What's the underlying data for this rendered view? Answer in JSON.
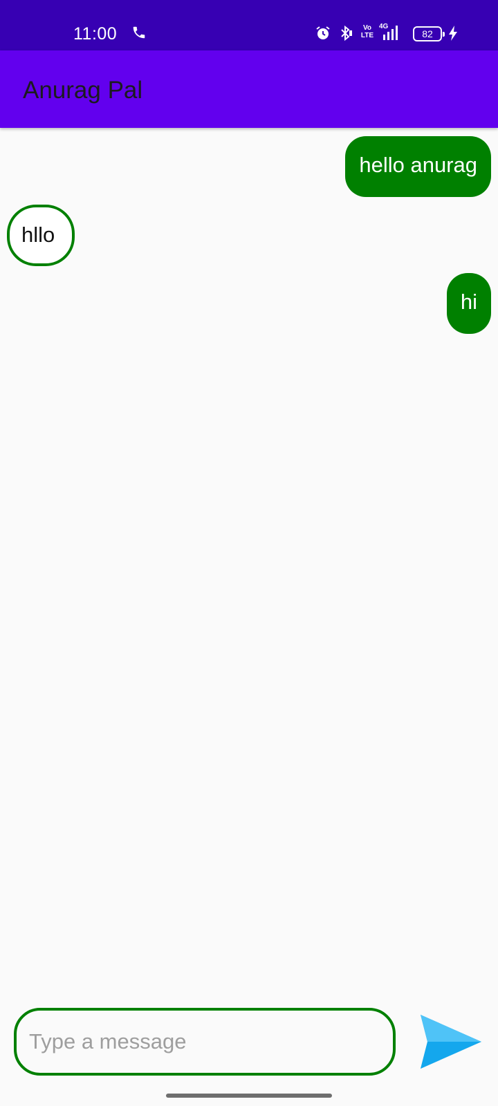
{
  "status_bar": {
    "time": "11:00",
    "volte_label": "Vo\nLTE",
    "network_label": "4G",
    "battery_level": "82",
    "icons": [
      "call-icon",
      "alarm-icon",
      "bluetooth-icon",
      "volte-icon",
      "signal-icon",
      "battery-icon",
      "charging-icon"
    ]
  },
  "app_bar": {
    "title": "Anurag Pal",
    "color": "#6200ee"
  },
  "messages": [
    {
      "text": "hello anurag",
      "direction": "sent"
    },
    {
      "text": "hllo",
      "direction": "received"
    },
    {
      "text": "hi",
      "direction": "sent"
    }
  ],
  "composer": {
    "placeholder": "Type a message",
    "value": "",
    "send_icon": "send-icon"
  },
  "colors": {
    "status_bar": "#3700b3",
    "primary": "#6200ee",
    "bubble_green": "#008000",
    "send_blue": "#29b6f6"
  }
}
